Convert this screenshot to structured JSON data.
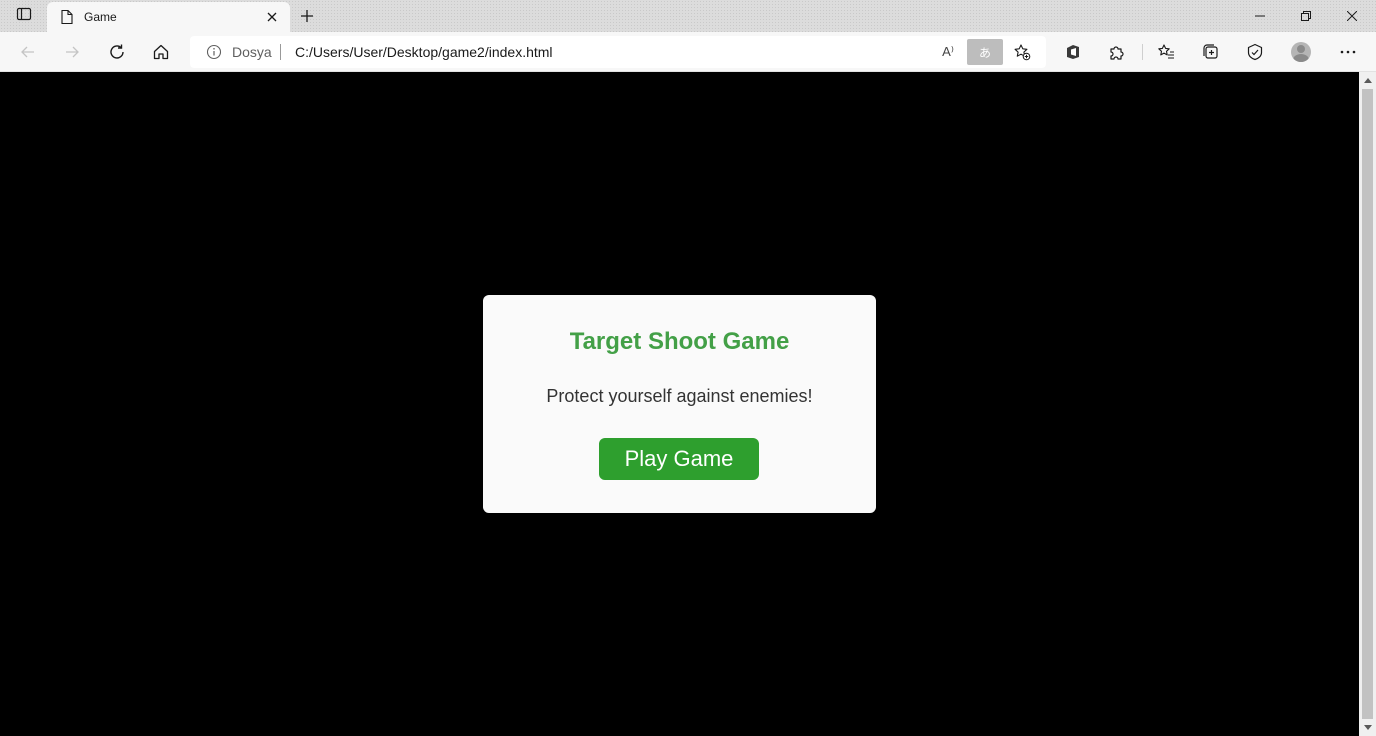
{
  "browser": {
    "tab": {
      "title": "Game"
    },
    "address_bar": {
      "site_info": "Dosya",
      "url": "C:/Users/User/Desktop/game2/index.html",
      "read_aloud_glyph": "A⁾",
      "translate_glyph": "あ"
    },
    "icons": [
      "tab-actions-icon",
      "page-icon",
      "close-icon",
      "plus-icon",
      "minimize-icon",
      "restore-icon",
      "close-window-icon",
      "back-icon",
      "forward-icon",
      "refresh-icon",
      "home-icon",
      "info-icon",
      "read-aloud-icon",
      "translate-icon",
      "add-favorite-icon",
      "office-icon",
      "extensions-icon",
      "favorites-icon",
      "collections-icon",
      "browser-essentials-icon",
      "profile-avatar",
      "more-icon"
    ]
  },
  "game": {
    "title": "Target Shoot Game",
    "subtitle": "Protect yourself against enemies!",
    "play_button": "Play Game",
    "colors": {
      "title": "#43a047",
      "button": "#2e9f2e",
      "background": "#000000",
      "dialog": "#fafafa"
    }
  }
}
